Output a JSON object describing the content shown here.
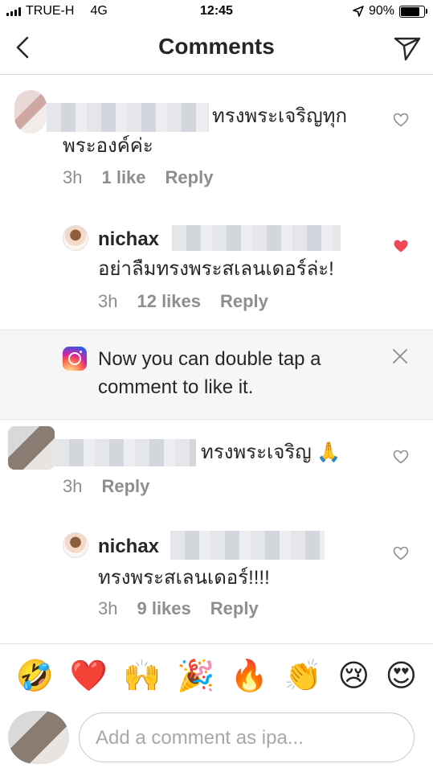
{
  "status_bar": {
    "carrier": "TRUE-H",
    "network": "4G",
    "time": "12:45",
    "battery": "90%",
    "battery_level": 0.9
  },
  "header": {
    "title": "Comments",
    "back_icon": "chevron-left-icon",
    "send_icon": "paper-plane-icon"
  },
  "comments": [
    {
      "text": "ทรงพระเจริญทุกพระองค์ค่ะ",
      "time": "3h",
      "likes": "1 like",
      "reply": "Reply",
      "liked": false
    },
    {
      "username": "nichax",
      "text": "อย่าลืมทรงพระสเลนเดอร์ล่ะ!",
      "time": "3h",
      "likes": "12 likes",
      "reply": "Reply",
      "liked": true
    },
    {
      "text": "ทรงพระเจริญ 🙏",
      "time": "3h",
      "reply": "Reply",
      "liked": false
    },
    {
      "username": "nichax",
      "text": "ทรงพระสเลนเดอร์!!!!",
      "time": "3h",
      "likes": "9 likes",
      "reply": "Reply",
      "liked": false
    }
  ],
  "tip_banner": {
    "text": "Now you can double tap a comment to like it.",
    "icon": "instagram-icon",
    "close_icon": "close-icon"
  },
  "emoji_bar": [
    "🤣",
    "❤️",
    "🙌",
    "🎉",
    "🔥",
    "👏",
    "😢",
    "😍"
  ],
  "composer": {
    "placeholder": "Add a comment as ipa..."
  },
  "colors": {
    "like_red": "#ed4956",
    "meta_gray": "#8e8e8e",
    "text": "#262626"
  }
}
